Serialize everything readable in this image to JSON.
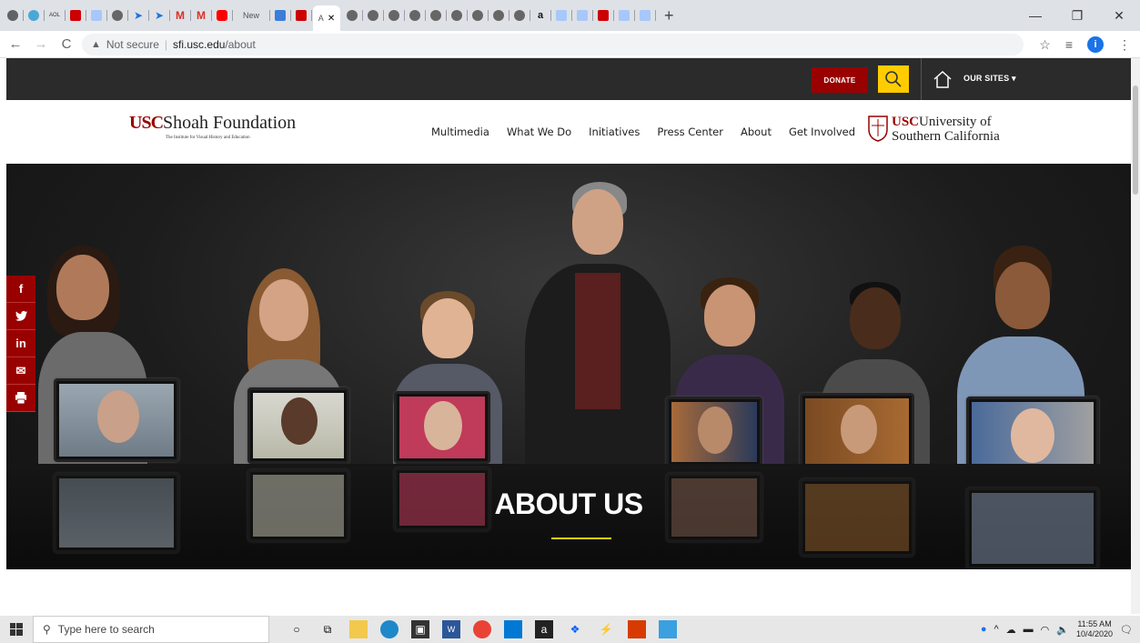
{
  "browser": {
    "active_tab_label": "A",
    "tab_new_label": "New",
    "tab_aol_label": "AOL",
    "address": {
      "security_label": "Not secure",
      "host": "sfi.usc.edu",
      "path": "/about"
    }
  },
  "header": {
    "donate_label": "DONATE",
    "our_sites_label": "OUR SITES"
  },
  "logo": {
    "usc": "USC",
    "foundation": "Shoah Foundation",
    "tagline": "The Institute for Visual History and Education"
  },
  "nav": {
    "items": [
      "Multimedia",
      "What We Do",
      "Initiatives",
      "Press Center",
      "About",
      "Get Involved"
    ]
  },
  "usc_logo": {
    "usc": "USC",
    "line1": "University of",
    "line2": "Southern California"
  },
  "hero": {
    "title": "ABOUT US"
  },
  "social": [
    "f",
    "t",
    "in",
    "mail",
    "print"
  ],
  "taskbar": {
    "search_placeholder": "Type here to search",
    "time": "11:55 AM",
    "date": "10/4/2020"
  },
  "colors": {
    "brand_red": "#990000",
    "brand_gold": "#ffcc00"
  }
}
